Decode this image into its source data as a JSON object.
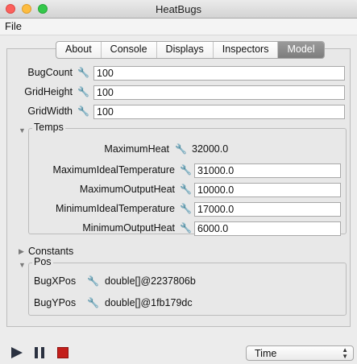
{
  "window": {
    "title": "HeatBugs"
  },
  "menu": {
    "file": "File"
  },
  "tabs": [
    {
      "label": "About"
    },
    {
      "label": "Console"
    },
    {
      "label": "Displays"
    },
    {
      "label": "Inspectors"
    },
    {
      "label": "Model",
      "active": true
    }
  ],
  "model": {
    "params": [
      {
        "label": "BugCount",
        "value": "100"
      },
      {
        "label": "GridHeight",
        "value": "100"
      },
      {
        "label": "GridWidth",
        "value": "100"
      }
    ],
    "temps": {
      "title": "Temps",
      "expanded": true,
      "max_heat": {
        "label": "MaximumHeat",
        "value": "32000.0"
      },
      "fields": [
        {
          "label": "MaximumIdealTemperature",
          "value": "31000.0"
        },
        {
          "label": "MaximumOutputHeat",
          "value": "10000.0"
        },
        {
          "label": "MinimumIdealTemperature",
          "value": "17000.0"
        },
        {
          "label": "MinimumOutputHeat",
          "value": "6000.0"
        }
      ]
    },
    "constants": {
      "title": "Constants",
      "expanded": false
    },
    "pos": {
      "title": "Pos",
      "expanded": true,
      "items": [
        {
          "label": "BugXPos",
          "value": "double[]@2237806b"
        },
        {
          "label": "BugYPos",
          "value": "double[]@1fb179dc"
        }
      ]
    }
  },
  "controls": {
    "time_select": "Time"
  },
  "icons": {
    "wrench": "wrench-icon",
    "play": "play-icon",
    "pause": "pause-icon",
    "stop": "stop-icon"
  },
  "colors": {
    "stop": "#c31e1a",
    "active_tab": "#8a8a8a"
  }
}
